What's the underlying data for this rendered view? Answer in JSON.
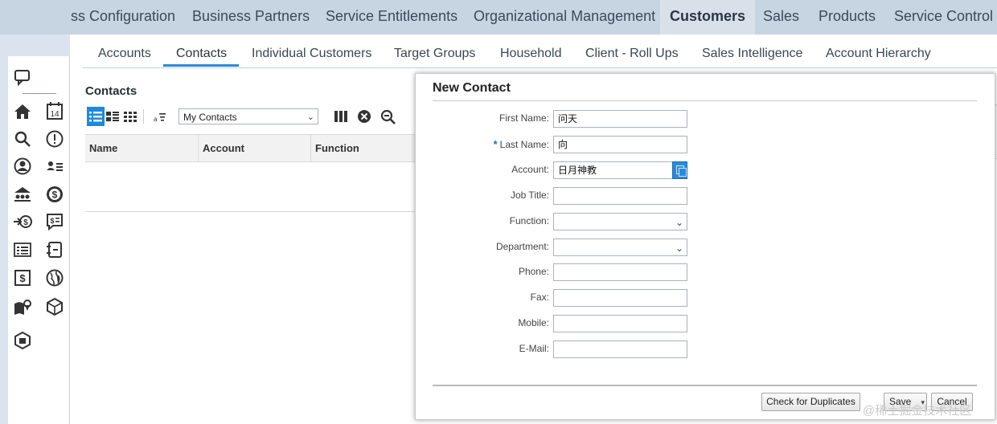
{
  "top_nav": {
    "items": [
      "ss Configuration",
      "Business Partners",
      "Service Entitlements",
      "Organizational Management",
      "Customers",
      "Sales",
      "Products",
      "Service Control C"
    ],
    "active": "Customers"
  },
  "rail_icons": [
    "chat-icon",
    "home-icon",
    "calendar-icon",
    "search-icon",
    "alert-icon",
    "person-icon",
    "contacts-icon",
    "bank-icon",
    "dollar-icon",
    "transfer-icon",
    "quote-icon",
    "list-icon",
    "notes-icon",
    "invoice-icon",
    "globe-icon",
    "map-icon",
    "box-icon",
    "package-icon"
  ],
  "calendar_day": "14",
  "sub_tabs": [
    "Accounts",
    "Contacts",
    "Individual Customers",
    "Target Groups",
    "Household",
    "Client - Roll Ups",
    "Sales Intelligence",
    "Account Hierarchy"
  ],
  "active_sub_tab": "Contacts",
  "list": {
    "title": "Contacts",
    "view_select": "My Contacts",
    "columns": [
      "Name",
      "Account",
      "Function"
    ]
  },
  "dialog": {
    "title": "New Contact",
    "fields": [
      {
        "label": "First Name:",
        "value": "问天",
        "required": false,
        "type": "text"
      },
      {
        "label": "Last Name:",
        "value": "向",
        "required": true,
        "type": "text"
      },
      {
        "label": "Account:",
        "value": "日月神教",
        "required": false,
        "type": "lookup"
      },
      {
        "label": "Job Title:",
        "value": "",
        "required": false,
        "type": "text"
      },
      {
        "label": "Function:",
        "value": "",
        "required": false,
        "type": "select"
      },
      {
        "label": "Department:",
        "value": "",
        "required": false,
        "type": "select"
      },
      {
        "label": "Phone:",
        "value": "",
        "required": false,
        "type": "text"
      },
      {
        "label": "Fax:",
        "value": "",
        "required": false,
        "type": "text"
      },
      {
        "label": "Mobile:",
        "value": "",
        "required": false,
        "type": "text"
      },
      {
        "label": "E-Mail:",
        "value": "",
        "required": false,
        "type": "text"
      }
    ],
    "buttons": {
      "check_duplicates": "Check for Duplicates",
      "save": "Save",
      "cancel": "Cancel"
    }
  },
  "watermark": "@稀土掘金技术社区",
  "colors": {
    "accent": "#2a8ad8",
    "top_bar": "#c7d4e1",
    "required_star": "#2a6ebb"
  }
}
